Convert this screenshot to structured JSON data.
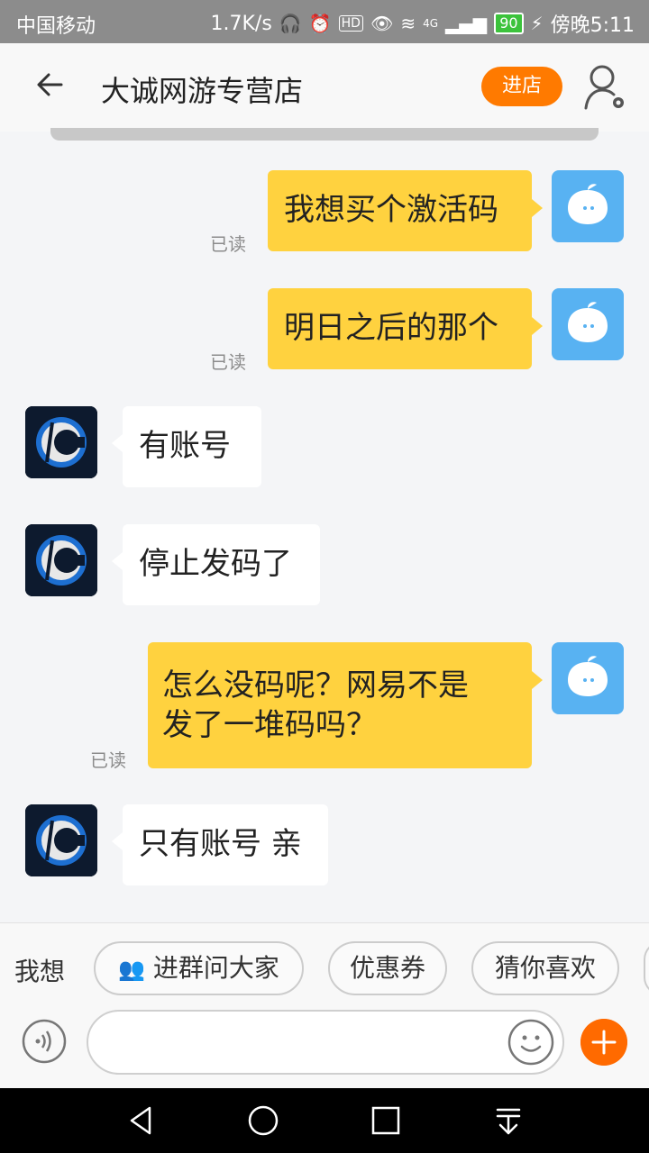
{
  "status_bar": {
    "carrier": "中国移动",
    "speed": "1.7K/s",
    "network": "4G",
    "battery": "90",
    "time": "傍晚5:11"
  },
  "header": {
    "title": "大诚网游专营店",
    "enter_label": "进店"
  },
  "messages": [
    {
      "text": "我想买个激活码",
      "read": "已读"
    },
    {
      "text": "明日之后的那个",
      "read": "已读"
    },
    {
      "text": "有账号"
    },
    {
      "text": "停止发码了"
    },
    {
      "line1": "怎么没码呢？网易不是",
      "line2": "发了一堆码吗？",
      "read": "已读"
    },
    {
      "text": "只有账号 亲"
    }
  ],
  "quick_bar": {
    "label": "我想",
    "chips": [
      "进群问大家",
      "优惠券",
      "猜你喜欢"
    ]
  },
  "colors": {
    "accent": "#ff7a00",
    "my_bubble": "#ffd23f",
    "my_avatar": "#58b2f2"
  }
}
